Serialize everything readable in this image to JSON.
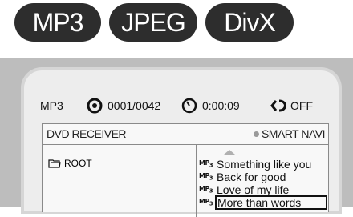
{
  "badges": [
    {
      "label": "MP3"
    },
    {
      "label": "JPEG"
    },
    {
      "label": "DivX"
    }
  ],
  "status_bar": {
    "format": "MP3",
    "track": "0001/0042",
    "time": "0:00:09",
    "repeat": "OFF"
  },
  "browser": {
    "title": "DVD RECEIVER",
    "smart_navi": "SMART NAVI",
    "folder": "ROOT",
    "files": [
      {
        "name": "Something like you",
        "type_icon": "mp3-file-icon"
      },
      {
        "name": "Back for good",
        "type_icon": "mp3-file-icon"
      },
      {
        "name": "Love of my life",
        "type_icon": "mp3-file-icon"
      },
      {
        "name": "More than words",
        "type_icon": "mp3-file-icon",
        "selected": true
      }
    ]
  },
  "colors": {
    "badge_bg": "#2d2d2d",
    "tv_frame": "#bdbdbd",
    "screen_bg": "#ededed",
    "browser_bg": "#f8f8f8"
  }
}
